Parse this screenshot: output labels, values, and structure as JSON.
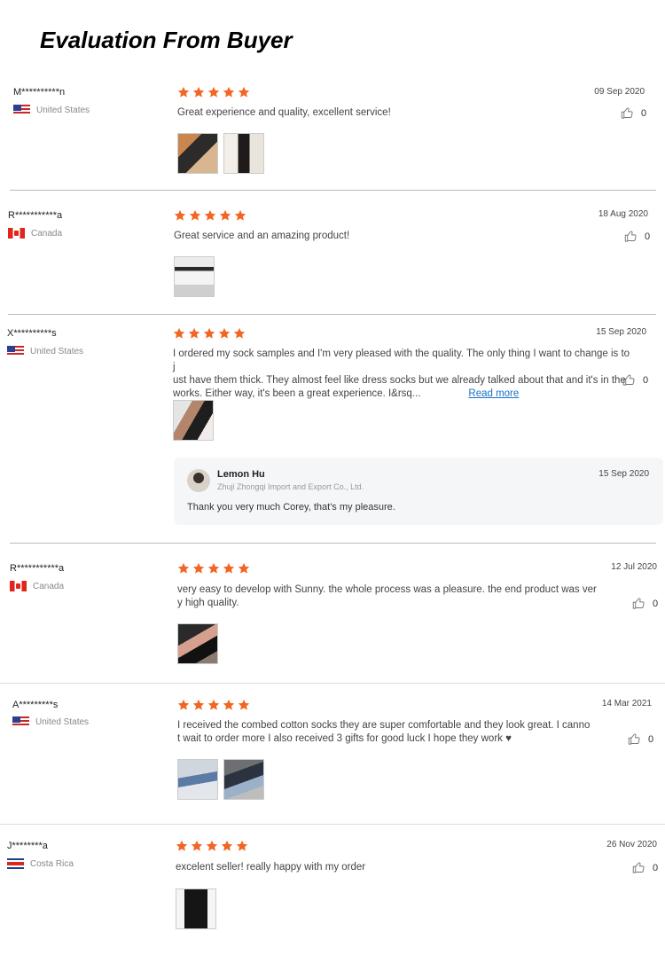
{
  "page": {
    "title": "Evaluation From Buyer"
  },
  "colors": {
    "star": "#f26522",
    "link": "#1a73c9",
    "reply_bg": "#f5f6f8"
  },
  "reviews": [
    {
      "buyer": "M**********n",
      "country": "United States",
      "flag": "us",
      "rating": 5,
      "date": "09 Sep 2020",
      "text": "Great experience and quality, excellent service!",
      "likes": "0",
      "photo_count": 2
    },
    {
      "buyer": "R***********a",
      "country": "Canada",
      "flag": "ca",
      "rating": 5,
      "date": "18 Aug 2020",
      "text": "Great service and an amazing product!",
      "likes": "0",
      "photo_count": 1
    },
    {
      "buyer": "X**********s",
      "country": "United States",
      "flag": "us",
      "rating": 5,
      "date": "15 Sep 2020",
      "text_lines": [
        "I ordered my sock samples and I'm very pleased with the quality. The only thing I want to change is to j",
        "ust have them thick. They almost feel like dress socks but we already talked about that and it's in the",
        "works. Either way, it's been a great experience. I&rsq..."
      ],
      "read_more": "Read more",
      "likes": "0",
      "photo_count": 1,
      "reply": {
        "name": "Lemon Hu",
        "company": "Zhuji Zhongqi Import and Export Co., Ltd.",
        "date": "15 Sep 2020",
        "text": "Thank you very much Corey, that's my pleasure."
      }
    },
    {
      "buyer": "R***********a",
      "country": "Canada",
      "flag": "ca",
      "rating": 5,
      "date": "12 Jul 2020",
      "text_lines": [
        "very easy to develop with Sunny. the whole process was a pleasure. the end product was ver",
        "y high quality."
      ],
      "likes": "0",
      "photo_count": 1
    },
    {
      "buyer": "A*********s",
      "country": "United States",
      "flag": "us",
      "rating": 5,
      "date": "14 Mar 2021",
      "text_lines": [
        "I received the combed cotton socks they are super comfortable and they look great. I canno",
        "t wait to order more I also received 3 gifts for good luck I hope they work ♥"
      ],
      "likes": "0",
      "photo_count": 2
    },
    {
      "buyer": "J********a",
      "country": "Costa Rica",
      "flag": "cr",
      "rating": 5,
      "date": "26 Nov 2020",
      "text": "excelent seller! really happy with my order",
      "likes": "0",
      "photo_count": 1
    }
  ]
}
